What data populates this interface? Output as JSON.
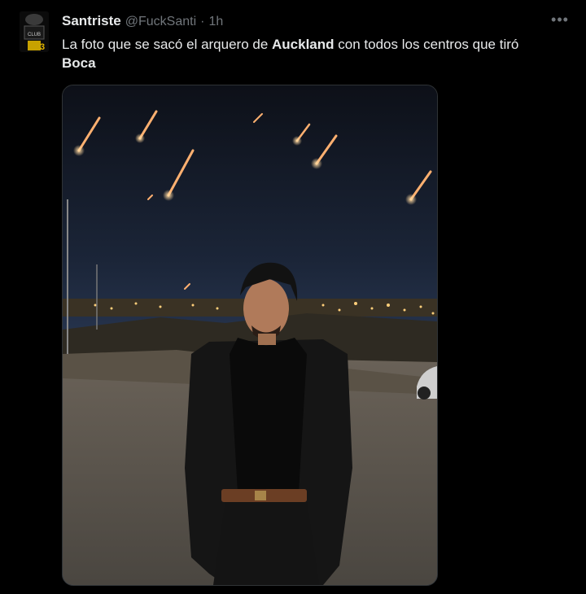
{
  "author": {
    "display_name": "Santriste",
    "handle": "@FuckSanti",
    "separator": "·",
    "time": "1h",
    "avatar_icon": "avatar-image"
  },
  "tweet": {
    "text_part1": "La foto que se sacó el arquero de ",
    "text_bold1": "Auckland",
    "text_part2": " con todos los centros que tiró ",
    "text_bold2": "Boca"
  },
  "more_icon": "more-options-icon"
}
